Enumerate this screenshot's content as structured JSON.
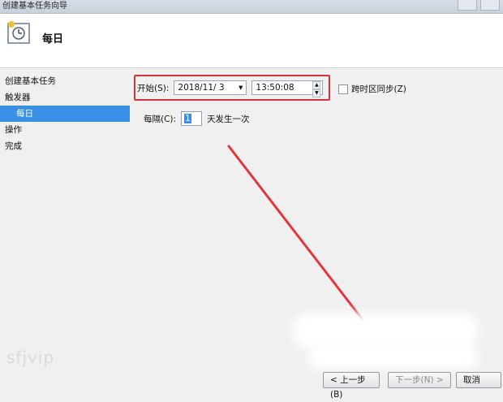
{
  "window": {
    "title": "创建基本任务向导"
  },
  "header": {
    "title": "每日"
  },
  "sidebar": {
    "items": [
      {
        "label": "创建基本任务"
      },
      {
        "label": "触发器"
      },
      {
        "label": "每日"
      },
      {
        "label": "操作"
      },
      {
        "label": "完成"
      }
    ]
  },
  "form": {
    "start_label": "开始(S):",
    "start_date": "2018/11/ 3",
    "start_time": "13:50:08",
    "sync_label": "跨时区同步(Z)",
    "sync_checked": false,
    "recur_label": "每隔(C):",
    "recur_value": "1",
    "recur_suffix": "天发生一次"
  },
  "buttons": {
    "back": "< 上一步(B)",
    "next": "下一步(N) >",
    "cancel": "取消"
  },
  "watermark": "sfjvip",
  "colors": {
    "highlight": "#d8343b",
    "selection": "#3a8fe6"
  }
}
